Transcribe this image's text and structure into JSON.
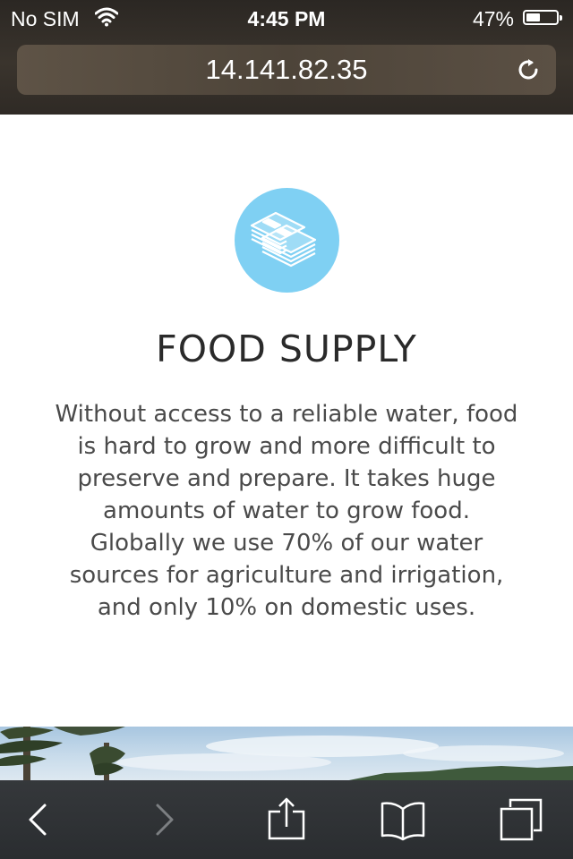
{
  "status_bar": {
    "carrier": "No SIM",
    "time": "4:45 PM",
    "battery_percent": "47%",
    "battery_level": 0.47,
    "wifi_icon": "wifi-icon",
    "battery_icon": "battery-icon"
  },
  "address_bar": {
    "url": "14.141.82.35",
    "reload_icon": "reload-icon"
  },
  "section": {
    "icon": "money-stack-icon",
    "icon_color": "#7fd0f3",
    "title": "FOOD SUPPLY",
    "body": "Without access to a reliable water, food is hard to grow and more difficult to preserve and prepare. It takes huge amounts of water to grow food. Globally we use 70% of our water sources for agriculture and irrigation, and only 10% on domestic uses."
  },
  "toolbar": {
    "back_icon": "back-arrow-icon",
    "forward_icon": "forward-arrow-icon",
    "share_icon": "share-icon",
    "bookmarks_icon": "bookmarks-icon",
    "tabs_icon": "tabs-icon"
  }
}
